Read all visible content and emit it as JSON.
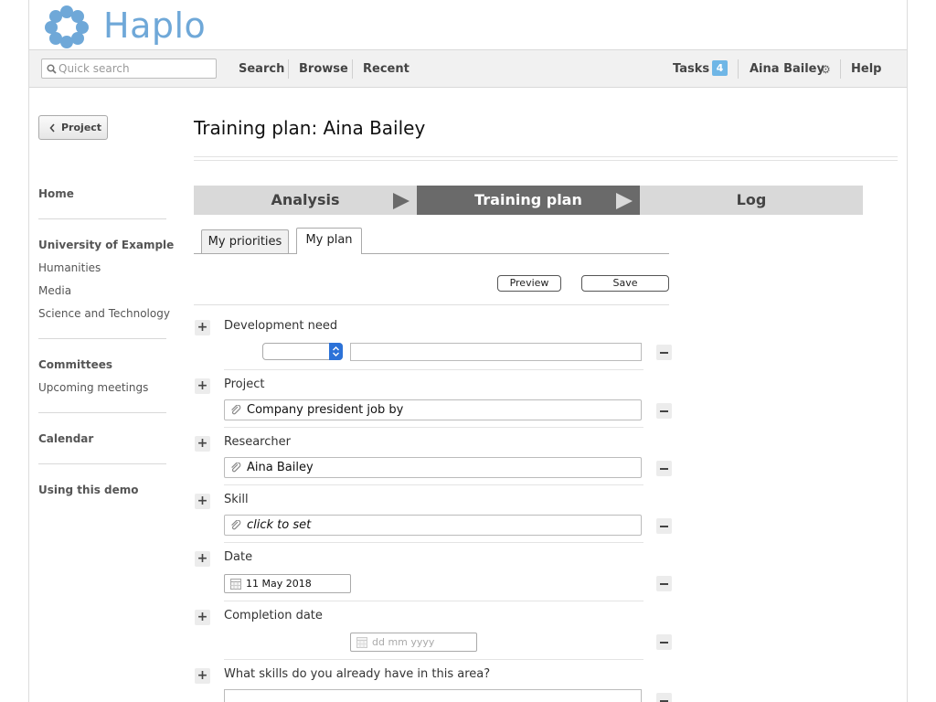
{
  "header": {
    "brand": "Haplo"
  },
  "nav": {
    "search_placeholder": "Quick search",
    "links": [
      "Search",
      "Browse",
      "Recent"
    ],
    "tasks_label": "Tasks",
    "tasks_count": "4",
    "user": "Aina Bailey",
    "help": "Help"
  },
  "sidebar": {
    "back_label": "Project",
    "home": "Home",
    "org": "University of Example",
    "org_items": [
      "Humanities",
      "Media",
      "Science and Technology"
    ],
    "committees": "Committees",
    "committee_items": [
      "Upcoming meetings"
    ],
    "calendar": "Calendar",
    "demo": "Using this demo"
  },
  "main": {
    "title": "Training plan: Aina Bailey",
    "steps": [
      "Analysis",
      "Training plan",
      "Log"
    ],
    "tabs": [
      "My priorities",
      "My plan"
    ],
    "preview": "Preview",
    "save": "Save",
    "fields": {
      "dev_need": "Development need",
      "project": "Project",
      "project_value": "Company president job by",
      "researcher": "Researcher",
      "researcher_value": "Aina Bailey",
      "skill": "Skill",
      "skill_value": "click to set",
      "date": "Date",
      "date_value": "11 May 2018",
      "completion": "Completion date",
      "completion_placeholder": "dd mm yyyy",
      "skills_have": "What skills do you already have in this area?"
    }
  }
}
